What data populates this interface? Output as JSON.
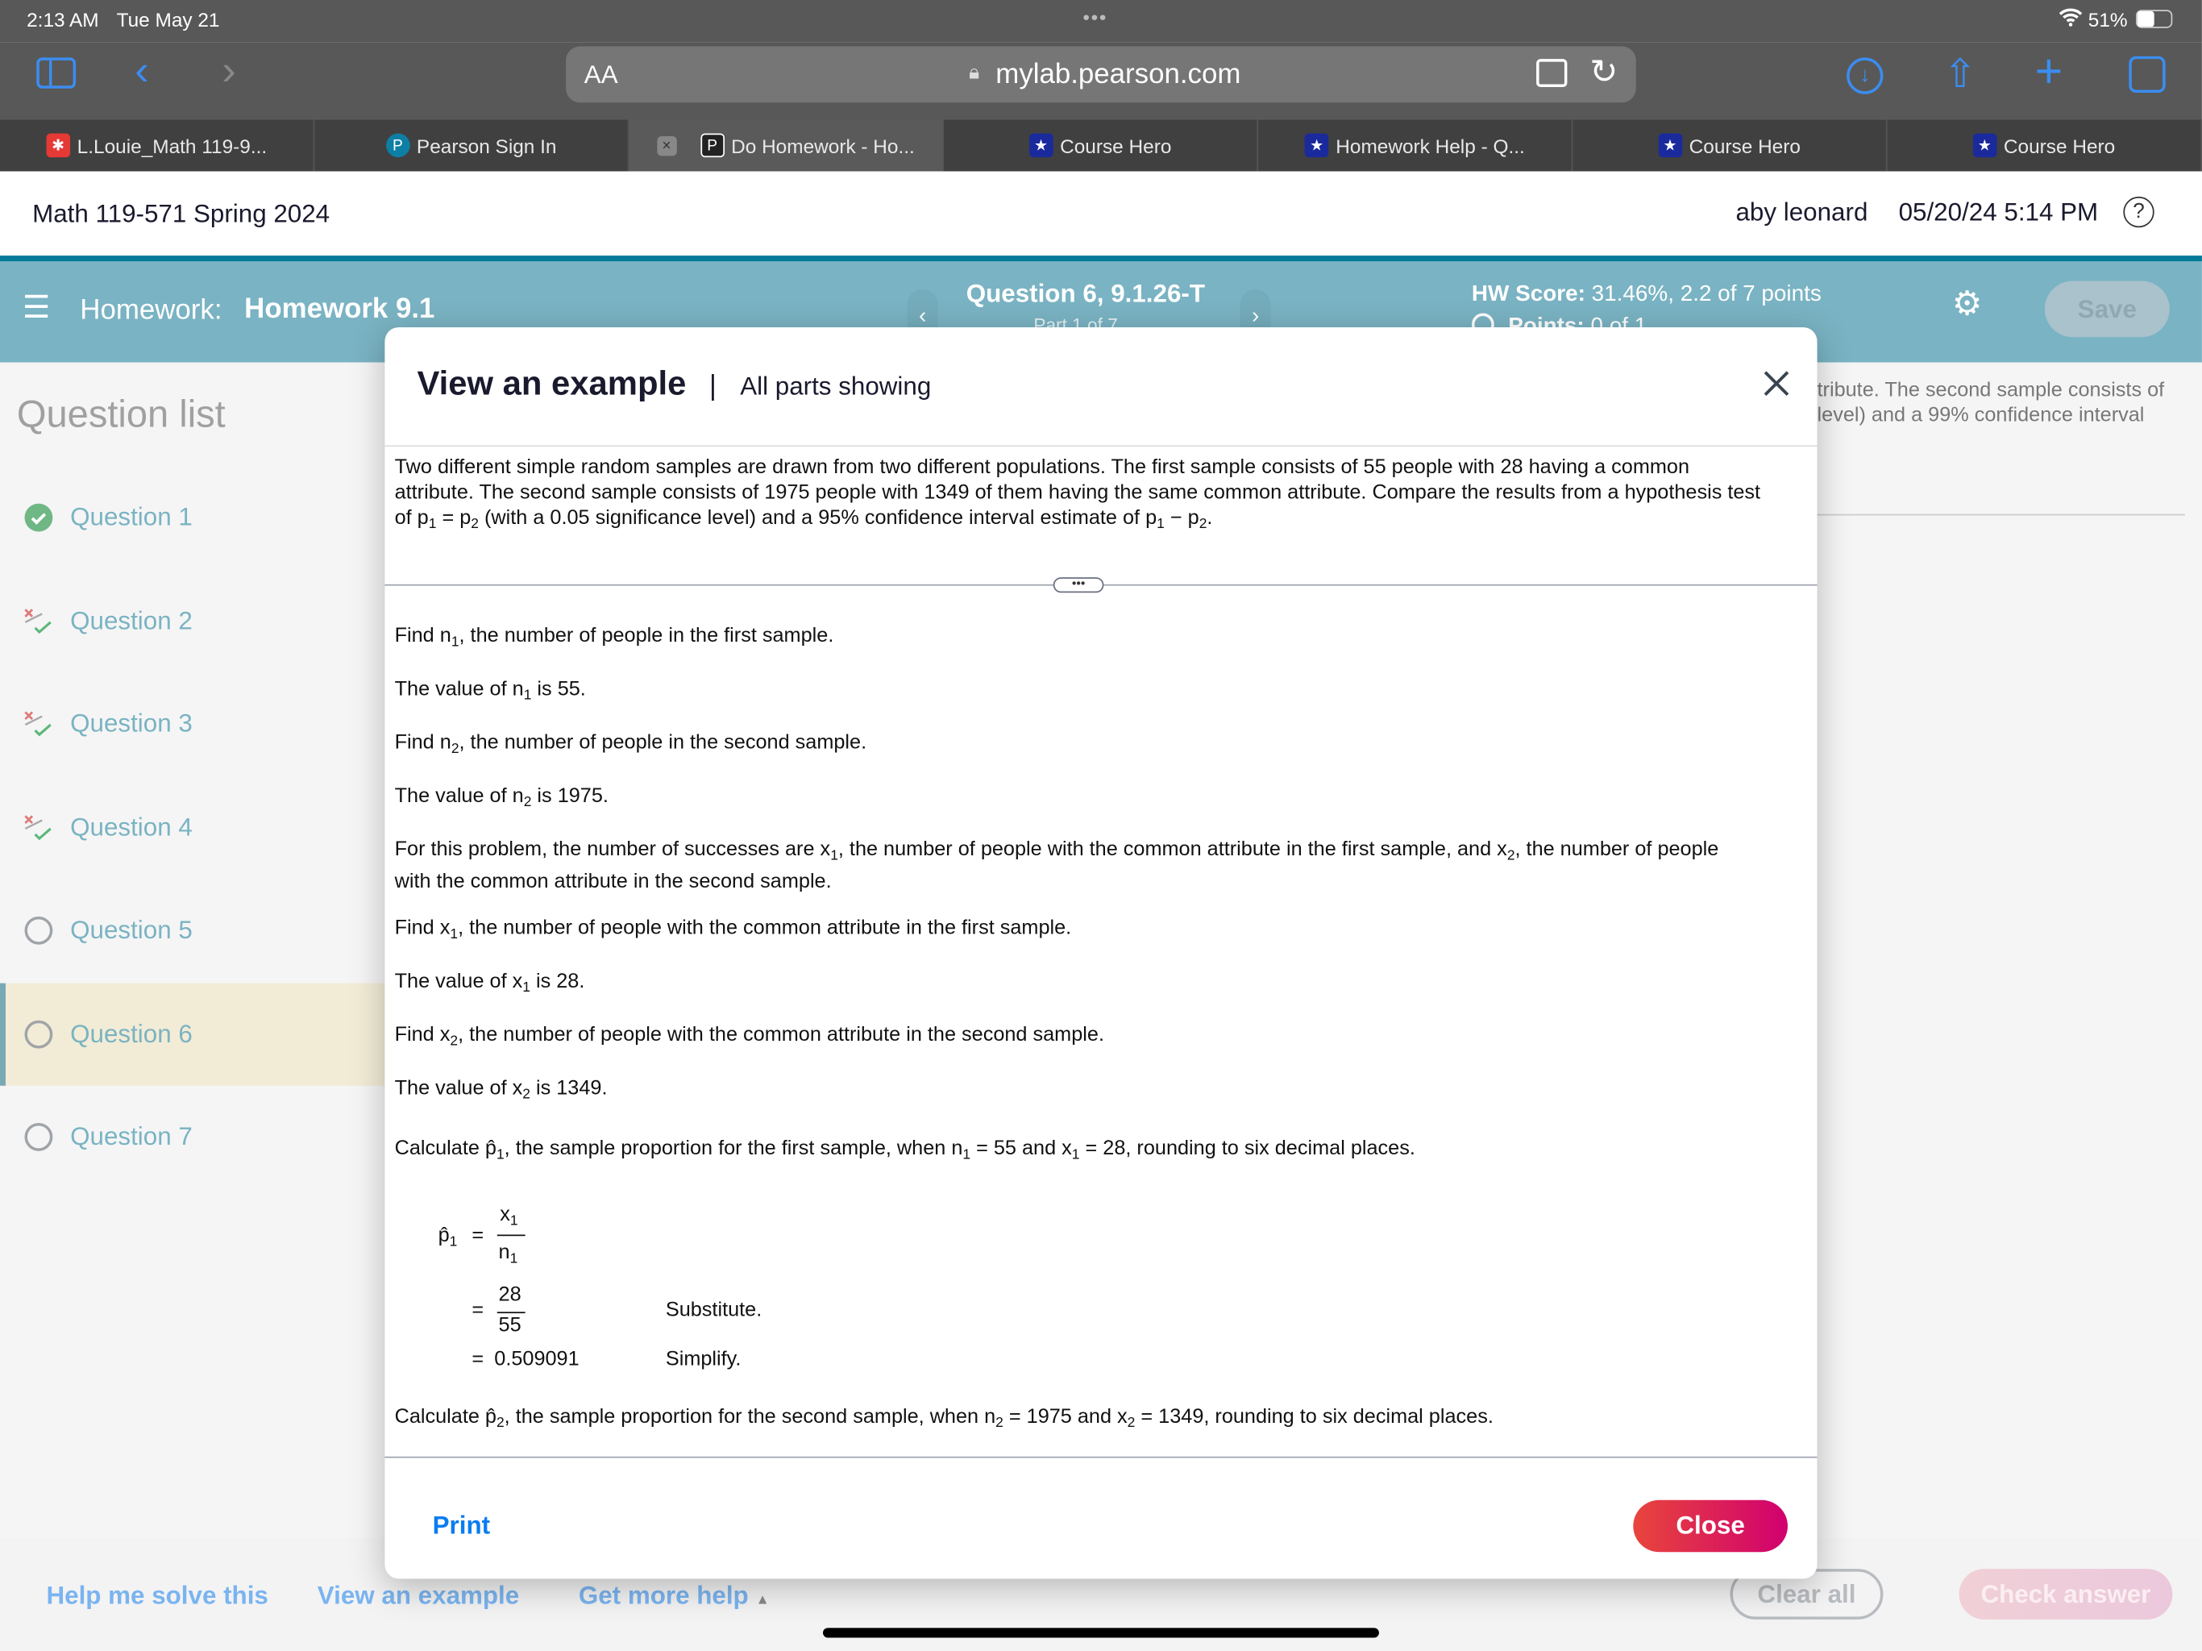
{
  "status_bar": {
    "time": "2:13 AM",
    "date": "Tue May 21",
    "battery": "51%",
    "battery_level": 0.51
  },
  "browser": {
    "text_size_label": "AA",
    "url": "mylab.pearson.com",
    "tabs": [
      {
        "label": "L.Louie_Math 119-9...",
        "icon": "calendar-logo-icon",
        "color": "#e53935",
        "active": false
      },
      {
        "label": "Pearson Sign In",
        "icon": "pearson-logo-icon",
        "color": "#0d7fa5",
        "active": false
      },
      {
        "label": "Do Homework - Ho...",
        "icon": "pearson-p-icon",
        "color": "#222222",
        "active": true
      },
      {
        "label": "Course Hero",
        "icon": "course-hero-icon",
        "color": "#1a2a9c",
        "active": false
      },
      {
        "label": "Homework Help - Q...",
        "icon": "course-hero-icon",
        "color": "#1a2a9c",
        "active": false
      },
      {
        "label": "Course Hero",
        "icon": "course-hero-icon",
        "color": "#1a2a9c",
        "active": false
      },
      {
        "label": "Course Hero",
        "icon": "course-hero-icon",
        "color": "#1a2a9c",
        "active": false
      }
    ]
  },
  "course": {
    "title": "Math 119-571 Spring 2024",
    "user": "aby leonard",
    "datetime": "05/20/24 5:14 PM"
  },
  "homework": {
    "prefix": "Homework:",
    "name": "Homework 9.1",
    "question": "Question 6, 9.1.26-T",
    "part": "Part 1 of 7",
    "score_label": "HW Score:",
    "score_value": "31.46%, 2.2 of 7 points",
    "points_label": "Points:",
    "points_value": "0 of 1",
    "save_label": "Save"
  },
  "sidebar": {
    "title": "Question list",
    "items": [
      {
        "label": "Question 1",
        "status": "correct"
      },
      {
        "label": "Question 2",
        "status": "partial"
      },
      {
        "label": "Question 3",
        "status": "partial"
      },
      {
        "label": "Question 4",
        "status": "partial"
      },
      {
        "label": "Question 5",
        "status": "unanswered"
      },
      {
        "label": "Question 6",
        "status": "unanswered",
        "current": true
      },
      {
        "label": "Question 7",
        "status": "unanswered"
      }
    ]
  },
  "background_text": {
    "line1": "tribute. The second sample consists of",
    "line2": "level) and a 99% confidence interval"
  },
  "modal": {
    "title": "View an example",
    "subtitle": "All parts showing",
    "intro": [
      [
        {
          "t": "Two different simple random samples are drawn from two different populations. The first sample consists of 55 people with 28 having a common"
        }
      ],
      [
        {
          "t": "attribute. The second sample consists of 1975 people with 1349 of them having the same common attribute. Compare the results from a hypothesis test"
        }
      ],
      [
        {
          "t": "of p"
        },
        {
          "s": "1"
        },
        {
          "t": " = p"
        },
        {
          "s": "2"
        },
        {
          "t": " (with a 0.05 significance level) and a 95% confidence interval estimate of p"
        },
        {
          "s": "1"
        },
        {
          "t": " − p"
        },
        {
          "s": "2"
        },
        {
          "t": "."
        }
      ]
    ],
    "steps": [
      [
        {
          "t": "Find n"
        },
        {
          "s": "1"
        },
        {
          "t": ", the number of people in the first sample."
        }
      ],
      [
        {
          "t": "The value of n"
        },
        {
          "s": "1"
        },
        {
          "t": " is 55."
        }
      ],
      [
        {
          "t": "Find n"
        },
        {
          "s": "2"
        },
        {
          "t": ", the number of people in the second sample."
        }
      ],
      [
        {
          "t": "The value of n"
        },
        {
          "s": "2"
        },
        {
          "t": " is 1975."
        }
      ],
      [
        {
          "t": "For this problem, the number of successes are x"
        },
        {
          "s": "1"
        },
        {
          "t": ", the number of people with the common attribute in the first sample, and x"
        },
        {
          "s": "2"
        },
        {
          "t": ", the number of people"
        }
      ],
      [
        {
          "t": "with the common attribute in the second sample."
        }
      ],
      [
        {
          "t": "Find x"
        },
        {
          "s": "1"
        },
        {
          "t": ", the number of people with the common attribute in the first sample."
        }
      ],
      [
        {
          "t": "The value of x"
        },
        {
          "s": "1"
        },
        {
          "t": " is 28."
        }
      ],
      [
        {
          "t": "Find x"
        },
        {
          "s": "2"
        },
        {
          "t": ", the number of people with the common attribute in the second sample."
        }
      ],
      [
        {
          "t": "The value of x"
        },
        {
          "s": "2"
        },
        {
          "t": " is 1349."
        }
      ],
      [
        {
          "t": "Calculate p̂"
        },
        {
          "s": "1"
        },
        {
          "t": ", the sample proportion for the first sample, when n"
        },
        {
          "s": "1"
        },
        {
          "t": " = 55 and x"
        },
        {
          "s": "1"
        },
        {
          "t": " = 28, rounding to six decimal places."
        }
      ],
      [
        {
          "t": "Calculate p̂"
        },
        {
          "s": "2"
        },
        {
          "t": ", the sample proportion for the second sample, when n"
        },
        {
          "s": "2"
        },
        {
          "t": " = 1975 and x"
        },
        {
          "s": "2"
        },
        {
          "t": " = 1349, rounding to six decimal places."
        }
      ]
    ],
    "formula": {
      "lhs": "p̂",
      "lhs_sub": "1",
      "eq": "=",
      "num_var": "x",
      "num_sub": "1",
      "den_var": "n",
      "den_sub": "1",
      "sub_num": "28",
      "sub_den": "55",
      "sub_note": "Substitute.",
      "result": "0.509091",
      "result_note": "Simplify."
    },
    "print_label": "Print",
    "close_label": "Close"
  },
  "bottom_bar": {
    "help_solve": "Help me solve this",
    "view_example": "View an example",
    "more_help": "Get more help",
    "clear_all": "Clear all",
    "check_answer": "Check answer"
  },
  "colors": {
    "header_teal": "#7ab3c3",
    "accent_line": "#007a99",
    "close_start": "#e8453c",
    "close_end": "#d1006f",
    "link_blue": "#0a7cf0"
  }
}
